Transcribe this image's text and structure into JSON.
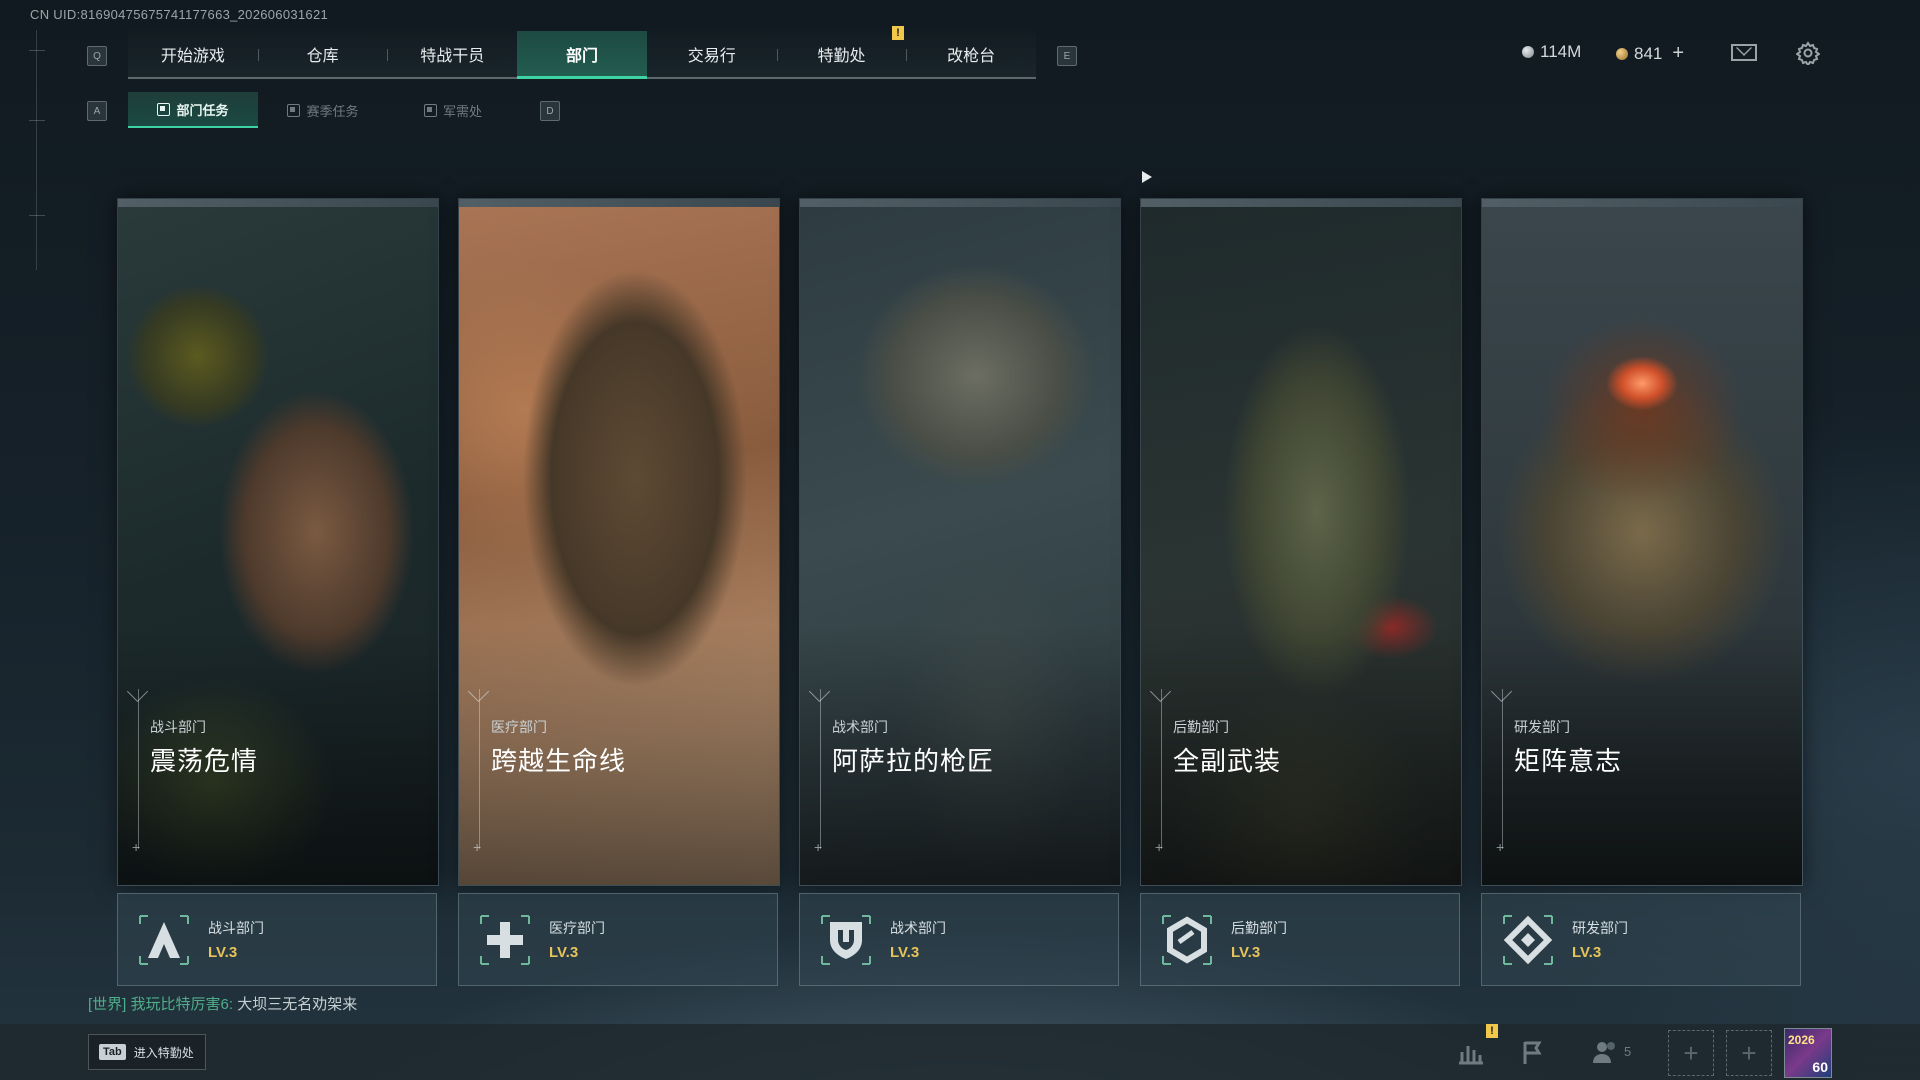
{
  "uid": "CN UID:816904756757411776​63_202606031621",
  "nav": {
    "left_key": "Q",
    "right_key": "E",
    "tabs": [
      "开始游戏",
      "仓库",
      "特战干员",
      "部门",
      "交易行",
      "特勤处",
      "改枪台"
    ],
    "active_index": 3,
    "alert": "!"
  },
  "subnav": {
    "left_key": "A",
    "right_key": "D",
    "tabs": [
      "部门任务",
      "赛季任务",
      "军需处"
    ],
    "active_index": 0
  },
  "currency": {
    "silver": "114M",
    "gold": "841",
    "gold_add": "+"
  },
  "cards": [
    {
      "category": "战斗部门",
      "title": "震荡危情"
    },
    {
      "category": "医疗部门",
      "title": "跨越生命线"
    },
    {
      "category": "战术部门",
      "title": "阿萨拉的枪匠"
    },
    {
      "category": "后勤部门",
      "title": "全副武装"
    },
    {
      "category": "研发部门",
      "title": "矩阵意志"
    }
  ],
  "departments": [
    {
      "name": "战斗部门",
      "level": "LV.3",
      "icon": "combat-a-icon"
    },
    {
      "name": "医疗部门",
      "level": "LV.3",
      "icon": "medical-cross-icon"
    },
    {
      "name": "战术部门",
      "level": "LV.3",
      "icon": "tactical-shield-icon"
    },
    {
      "name": "后勤部门",
      "level": "LV.3",
      "icon": "logistics-hex-icon"
    },
    {
      "name": "研发部门",
      "level": "LV.3",
      "icon": "research-diamond-icon"
    }
  ],
  "chat": {
    "channel": "[世界]",
    "user": "我玩比特厉害6:",
    "message": "大坝三无名劝架来"
  },
  "bottom": {
    "tab_key": "Tab",
    "tab_label": "进入特勤处",
    "friends_count": "5",
    "badge_year": "2026",
    "badge_num": "60",
    "stats_alert": "!"
  },
  "colors": {
    "accent": "#3fd3a4",
    "level": "#e7c45a",
    "chat_green": "#4fae8a"
  }
}
